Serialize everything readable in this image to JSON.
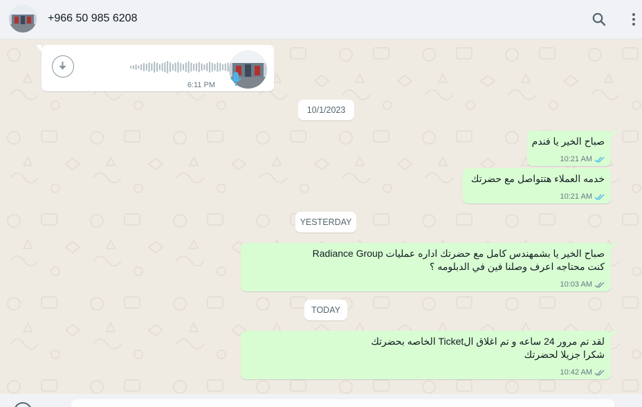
{
  "header": {
    "contact_name": "+966 50 985 6208",
    "search_icon": "search-icon",
    "menu_icon": "menu-vertical-icon"
  },
  "colors": {
    "chat_bg": "#efeae2",
    "incoming": "#ffffff",
    "outgoing": "#d9fdd3",
    "read_tick": "#53bdeb",
    "delivered_tick": "#8696a0"
  },
  "voice_message": {
    "time": "6:11 PM",
    "download_icon": "download-icon",
    "mic_icon": "mic-icon"
  },
  "separators": {
    "date_1": "10/1/2023",
    "yesterday": "YESTERDAY",
    "today": "TODAY"
  },
  "messages": [
    {
      "lines": [
        "صباح الخير يا فندم"
      ],
      "time": "10:21 AM",
      "status": "read"
    },
    {
      "lines": [
        "خدمه العملاء هتتواصل مع حضرتك"
      ],
      "time": "10:21 AM",
      "status": "read"
    },
    {
      "lines": [
        "صباح الخير يا بشمهندس كامل مع حضرتك اداره عمليات Radiance Group",
        "كنت محتاجه اعرف وصلنا فين في الدبلومه ؟"
      ],
      "time": "10:03 AM",
      "status": "delivered"
    },
    {
      "lines": [
        "لقد تم مرور 24 ساعه و تم اغلاق الTicket الخاصه بحضرتك",
        "شكرا جزيلا لحضرتك"
      ],
      "time": "10:42 AM",
      "status": "delivered"
    }
  ]
}
